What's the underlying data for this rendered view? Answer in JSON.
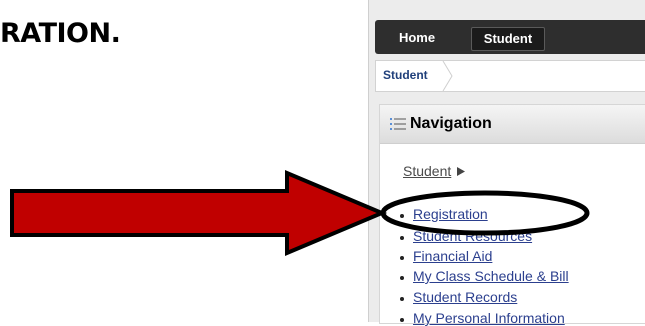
{
  "heading": "RATION.",
  "portal": {
    "tabs": {
      "home": "Home",
      "student": "Student"
    },
    "breadcrumb": "Student",
    "navigation": {
      "title": "Navigation",
      "section_link": "Student",
      "items": [
        "Registration",
        "Student Resources",
        "Financial Aid",
        "My Class Schedule & Bill",
        "Student Records",
        "My Personal Information"
      ]
    }
  },
  "colors": {
    "arrow_fill": "#c00000",
    "arrow_stroke": "#000000",
    "highlight_ellipse": "#000000",
    "topbar": "#2e2e2e",
    "link": "#2b3f8e"
  }
}
